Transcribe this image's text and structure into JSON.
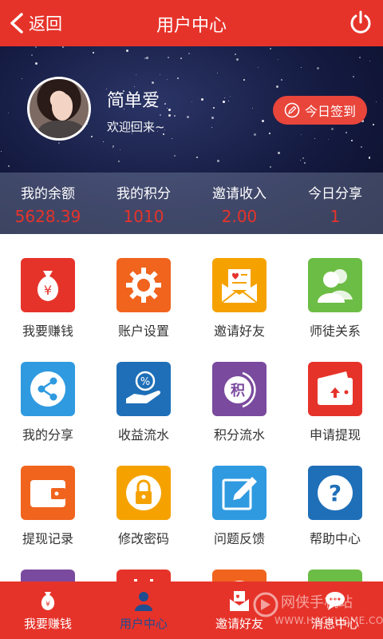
{
  "header": {
    "back_label": "返回",
    "title": "用户中心"
  },
  "profile": {
    "username": "简单爱",
    "welcome": "欢迎回来~",
    "signin_label": "今日签到"
  },
  "stats": [
    {
      "label": "我的余额",
      "value": "5628.39"
    },
    {
      "label": "我的积分",
      "value": "1010"
    },
    {
      "label": "邀请收入",
      "value": "2.00"
    },
    {
      "label": "今日分享",
      "value": "1"
    }
  ],
  "grid": [
    {
      "label": "我要赚钱",
      "icon": "money-bag-icon",
      "color": "#e6332a"
    },
    {
      "label": "账户设置",
      "icon": "gear-icon",
      "color": "#f0641e"
    },
    {
      "label": "邀请好友",
      "icon": "invite-letter-icon",
      "color": "#f5a200"
    },
    {
      "label": "师徒关系",
      "icon": "users-icon",
      "color": "#6cbd45"
    },
    {
      "label": "我的分享",
      "icon": "share-icon",
      "color": "#2f9ae0"
    },
    {
      "label": "收益流水",
      "icon": "income-hand-icon",
      "color": "#1e6fb8"
    },
    {
      "label": "积分流水",
      "icon": "points-icon",
      "color": "#7a4a9e"
    },
    {
      "label": "申请提现",
      "icon": "wallet-withdraw-icon",
      "color": "#e6332a"
    },
    {
      "label": "提现记录",
      "icon": "wallet-icon",
      "color": "#f0641e"
    },
    {
      "label": "修改密码",
      "icon": "lock-icon",
      "color": "#f5a200"
    },
    {
      "label": "问题反馈",
      "icon": "pencil-edit-icon",
      "color": "#2f9ae0"
    },
    {
      "label": "帮助中心",
      "icon": "question-icon",
      "color": "#1e6fb8"
    },
    {
      "label": "",
      "icon": "partial-purple-icon",
      "color": "#7a4a9e"
    },
    {
      "label": "",
      "icon": "calendar-icon",
      "color": "#e6332a"
    },
    {
      "label": "",
      "icon": "partial-orange-icon",
      "color": "#f0641e"
    },
    {
      "label": "",
      "icon": "chat-icon",
      "color": "#6cbd45"
    }
  ],
  "tabs": [
    {
      "label": "我要赚钱",
      "icon": "money-bag-icon"
    },
    {
      "label": "用户中心",
      "icon": "user-icon"
    },
    {
      "label": "邀请好友",
      "icon": "invite-letter-icon"
    },
    {
      "label": "消息中心",
      "icon": "message-icon"
    }
  ],
  "watermark": {
    "title": "网侠手机站",
    "url": "WWW.HACKHOME.COM"
  }
}
